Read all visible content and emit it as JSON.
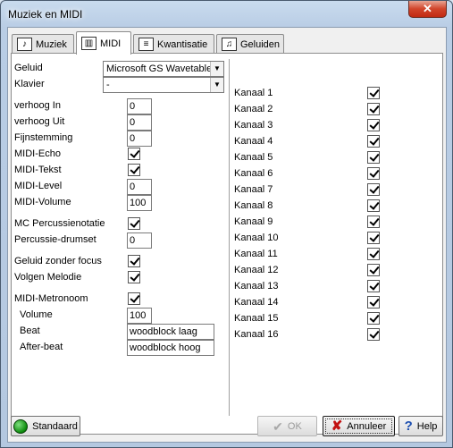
{
  "window": {
    "title": "Muziek en MIDI",
    "close_glyph": "✕"
  },
  "tabs": [
    {
      "label": "Muziek",
      "icon": "music-note-icon"
    },
    {
      "label": "MIDI",
      "icon": "midi-keyboard-icon"
    },
    {
      "label": "Kwantisatie",
      "icon": "quantize-icon"
    },
    {
      "label": "Geluiden",
      "icon": "sounds-icon"
    }
  ],
  "midi": {
    "geluid_label": "Geluid",
    "geluid_value": "Microsoft GS Wavetable",
    "klavier_label": "Klavier",
    "klavier_value": "-",
    "verhoog_in_label": "verhoog In",
    "verhoog_in_value": "0",
    "verhoog_uit_label": "verhoog Uit",
    "verhoog_uit_value": "0",
    "fijnstemming_label": "Fijnstemming",
    "fijnstemming_value": "0",
    "midi_echo_label": "MIDI-Echo",
    "midi_echo_checked": true,
    "midi_tekst_label": "MIDI-Tekst",
    "midi_tekst_checked": true,
    "midi_level_label": "MIDI-Level",
    "midi_level_value": "0",
    "midi_volume_label": "MIDI-Volume",
    "midi_volume_value": "100",
    "mc_percussie_label": "MC Percussienotatie",
    "mc_percussie_checked": true,
    "percussie_drumset_label": "Percussie-drumset",
    "percussie_drumset_value": "0",
    "geluid_zonder_focus_label": "Geluid zonder focus",
    "geluid_zonder_focus_checked": true,
    "volgen_melodie_label": "Volgen Melodie",
    "volgen_melodie_checked": true,
    "metronoom_label": "MIDI-Metronoom",
    "metronoom_checked": true,
    "volume_label": "Volume",
    "volume_value": "100",
    "beat_label": "Beat",
    "beat_value": "woodblock laag",
    "afterbeat_label": "After-beat",
    "afterbeat_value": "woodblock hoog"
  },
  "channels": [
    {
      "label": "Kanaal 1",
      "checked": true
    },
    {
      "label": "Kanaal 2",
      "checked": true
    },
    {
      "label": "Kanaal 3",
      "checked": true
    },
    {
      "label": "Kanaal 4",
      "checked": true
    },
    {
      "label": "Kanaal 5",
      "checked": true
    },
    {
      "label": "Kanaal 6",
      "checked": true
    },
    {
      "label": "Kanaal 7",
      "checked": true
    },
    {
      "label": "Kanaal 8",
      "checked": true
    },
    {
      "label": "Kanaal 9",
      "checked": true
    },
    {
      "label": "Kanaal 10",
      "checked": true
    },
    {
      "label": "Kanaal 11",
      "checked": true
    },
    {
      "label": "Kanaal 12",
      "checked": true
    },
    {
      "label": "Kanaal 13",
      "checked": true
    },
    {
      "label": "Kanaal 14",
      "checked": true
    },
    {
      "label": "Kanaal 15",
      "checked": true
    },
    {
      "label": "Kanaal 16",
      "checked": true
    }
  ],
  "buttons": {
    "standaard": "Standaard",
    "ok": "OK",
    "annuleer": "Annuleer",
    "help": "Help"
  }
}
